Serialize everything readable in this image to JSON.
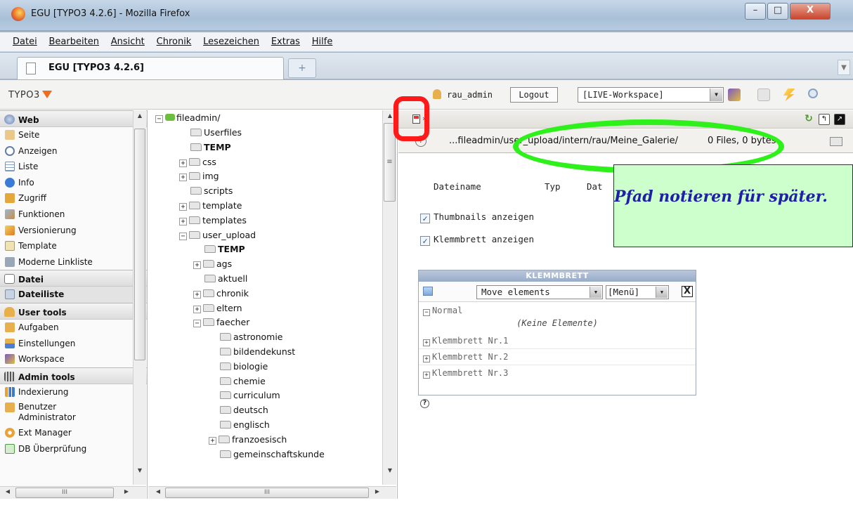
{
  "window": {
    "title": "EGU [TYPO3 4.2.6] - Mozilla Firefox",
    "min": "–",
    "max": "□",
    "close": "X"
  },
  "menubar": {
    "items": [
      "Datei",
      "Bearbeiten",
      "Ansicht",
      "Chronik",
      "Lesezeichen",
      "Extras",
      "Hilfe"
    ]
  },
  "tabs": {
    "active_label": "EGU [TYPO3 4.2.6]",
    "new_tab": "+"
  },
  "typo3_header": {
    "logo": "TYPO3",
    "user": "rau_admin",
    "logout": "Logout",
    "workspace": "[LIVE-Workspace]"
  },
  "module_menu": {
    "groups": [
      {
        "label": "Web",
        "items": [
          "Seite",
          "Anzeigen",
          "Liste",
          "Info",
          "Zugriff",
          "Funktionen",
          "Versionierung",
          "Template",
          "Moderne Linkliste"
        ]
      },
      {
        "label": "Datei",
        "items": [
          "Dateiliste"
        ]
      },
      {
        "label": "User tools",
        "items": [
          "Aufgaben",
          "Einstellungen",
          "Workspace"
        ]
      },
      {
        "label": "Admin tools",
        "items": [
          "Indexierung",
          "Benutzer Administrator",
          "Ext Manager",
          "DB Überprüfung"
        ]
      }
    ],
    "active_item": "Dateiliste"
  },
  "tree": {
    "root": "fileadmin/",
    "nodes": [
      {
        "label": "Userfiles",
        "depth": 1,
        "expand": "",
        "bold": false
      },
      {
        "label": "TEMP",
        "depth": 1,
        "expand": "",
        "bold": true
      },
      {
        "label": "css",
        "depth": 1,
        "expand": "+",
        "bold": false
      },
      {
        "label": "img",
        "depth": 1,
        "expand": "+",
        "bold": false
      },
      {
        "label": "scripts",
        "depth": 1,
        "expand": "",
        "bold": false
      },
      {
        "label": "template",
        "depth": 1,
        "expand": "+",
        "bold": false
      },
      {
        "label": "templates",
        "depth": 1,
        "expand": "+",
        "bold": false
      },
      {
        "label": "user_upload",
        "depth": 1,
        "expand": "−",
        "bold": false
      },
      {
        "label": "TEMP",
        "depth": 2,
        "expand": "",
        "bold": true
      },
      {
        "label": "ags",
        "depth": 2,
        "expand": "+",
        "bold": false
      },
      {
        "label": "aktuell",
        "depth": 2,
        "expand": "",
        "bold": false
      },
      {
        "label": "chronik",
        "depth": 2,
        "expand": "+",
        "bold": false
      },
      {
        "label": "eltern",
        "depth": 2,
        "expand": "+",
        "bold": false
      },
      {
        "label": "faecher",
        "depth": 2,
        "expand": "−",
        "bold": false
      },
      {
        "label": "astronomie",
        "depth": 3,
        "expand": "",
        "bold": false
      },
      {
        "label": "bildendekunst",
        "depth": 3,
        "expand": "",
        "bold": false
      },
      {
        "label": "biologie",
        "depth": 3,
        "expand": "",
        "bold": false
      },
      {
        "label": "chemie",
        "depth": 3,
        "expand": "",
        "bold": false
      },
      {
        "label": "curriculum",
        "depth": 3,
        "expand": "",
        "bold": false
      },
      {
        "label": "deutsch",
        "depth": 3,
        "expand": "",
        "bold": false
      },
      {
        "label": "englisch",
        "depth": 3,
        "expand": "",
        "bold": false
      },
      {
        "label": "franzoesisch",
        "depth": 3,
        "expand": "+",
        "bold": false
      },
      {
        "label": "gemeinschaftskunde",
        "depth": 3,
        "expand": "",
        "bold": false
      }
    ]
  },
  "content": {
    "path": "...fileadmin/user_upload/intern/rau/Meine_Galerie/",
    "files_info": "0 Files, 0 bytes",
    "columns": [
      "Dateiname",
      "Typ",
      "Dat"
    ],
    "thumbnails": "Thumbnails anzeigen",
    "clipboard_show": "Klemmbrett anzeigen"
  },
  "clipboard": {
    "title": "KLEMMBRETT",
    "mode": "Move elements",
    "menu": "[Menü]",
    "close": "X",
    "normal": "Normal",
    "empty": "(Keine Elemente)",
    "pads": [
      "Klemmbrett Nr.1",
      "Klemmbrett Nr.2",
      "Klemmbrett Nr.3"
    ],
    "help": "?"
  },
  "annotation": {
    "callout": "Pfad notieren für später."
  },
  "colors": {
    "annotation_red": "#ff1a1a",
    "annotation_green": "#2ef01a",
    "callout_bg": "#ccffcc",
    "callout_text": "#1f1fa8"
  }
}
